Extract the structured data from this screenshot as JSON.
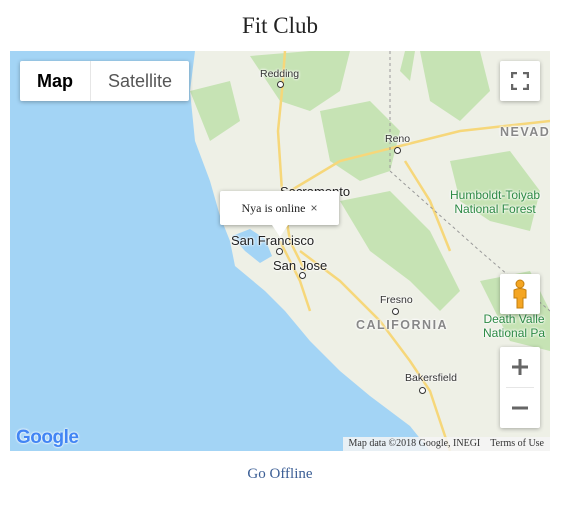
{
  "page": {
    "title": "Fit Club"
  },
  "map": {
    "type_control": {
      "map_label": "Map",
      "satellite_label": "Satellite",
      "selected": "Map"
    },
    "labels": {
      "redding": "Redding",
      "reno": "Reno",
      "nevada": "NEVAD",
      "sacramento": "Sacramento",
      "san_francisco": "San Francisco",
      "san_jose": "San Jose",
      "fresno": "Fresno",
      "california": "CALIFORNIA",
      "bakersfield": "Bakersfield",
      "humboldt_line1": "Humboldt-Toiyab",
      "humboldt_line2": "National Forest",
      "death_valley_line1": "Death Valle",
      "death_valley_line2": "National Pa"
    },
    "info_window": {
      "text": "Nya is online",
      "close": "×"
    },
    "logo": "Google",
    "attribution": {
      "data": "Map data ©2018 Google, INEGI",
      "terms": "Terms of Use"
    },
    "colors": {
      "water": "#a3d4f5",
      "land": "#eef0e6",
      "park": "#c6e3b4",
      "highway": "#f6d77a"
    }
  },
  "footer": {
    "go_offline": "Go Offline"
  }
}
